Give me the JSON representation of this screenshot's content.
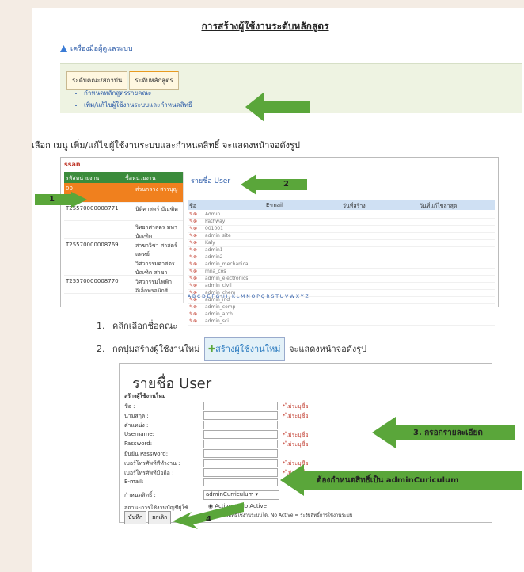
{
  "title": "การสร้างผู้ใช้งานระดับหลักสูตร",
  "admin": {
    "label": "เครื่องมือผู้ดูแลระบบ"
  },
  "tabs": [
    "ระดับคณะ/สถาบัน",
    "ระดับหลักสูตร"
  ],
  "menu": [
    "กำหนดหลักสูตรรายคณะ",
    "เพิ่ม/แก้ไขผู้ใช้งานระบบและกำหนดสิทธิ์"
  ],
  "sentence": "เลือก เมนู เพิ่ม/แก้ไขผู้ใช้งานระบบและกำหนดสิทธิ์ จะแสดงหน้าจอดังรูป",
  "shot1": {
    "logo": "ssan",
    "right": "",
    "left_headers": [
      "รหัสหน่วยงาน",
      "ชื่อหน่วยงาน"
    ],
    "left_rows": [
      {
        "code": "00",
        "name": "ส่วนกลาง สารบุญ",
        "selected": true
      },
      {
        "code": "T25570000008771",
        "name": "นิติศาสตร์ บัณฑิต",
        "selected": false
      },
      {
        "code": "",
        "name": "วิทยาศาสตร มหาบัณฑิต",
        "selected": false
      },
      {
        "code": "T25570000008769",
        "name": "สาขาวิชา ศาสตร์แพทย์",
        "selected": false
      },
      {
        "code": "",
        "name": "วิศวกรรมศาสตร บัณฑิต สาขา",
        "selected": false
      },
      {
        "code": "T25570000008770",
        "name": "วิศวกรรมไฟฟ้า อิเล็กทรอนิกส์",
        "selected": false
      }
    ],
    "list_title": "รายชื่อ User",
    "list_headers": [
      "ชื่อ",
      "E-mail",
      "วันที่สร้าง",
      "วันที่แก้ไขล่าสุด"
    ],
    "rows": [
      {
        "name": "Admin",
        "email": "",
        "created": "",
        "updated": ""
      },
      {
        "name": "Pathway",
        "email": "",
        "created": "",
        "updated": ""
      },
      {
        "name": "001001",
        "email": "",
        "created": "",
        "updated": ""
      },
      {
        "name": "admin_site",
        "email": "",
        "created": "",
        "updated": ""
      },
      {
        "name": "Kaly",
        "email": "",
        "created": "",
        "updated": ""
      },
      {
        "name": "admin1",
        "email": "",
        "created": "",
        "updated": ""
      },
      {
        "name": "admin2",
        "email": "",
        "created": "",
        "updated": ""
      },
      {
        "name": "admin_mechanical",
        "email": "",
        "created": "",
        "updated": ""
      },
      {
        "name": "mna_cos",
        "email": "",
        "created": "",
        "updated": ""
      },
      {
        "name": "admin_electronics",
        "email": "",
        "created": "",
        "updated": ""
      },
      {
        "name": "admin_civil",
        "email": "",
        "created": "",
        "updated": ""
      },
      {
        "name": "admin_chem",
        "email": "",
        "created": "",
        "updated": ""
      },
      {
        "name": "admin_ind",
        "email": "",
        "created": "",
        "updated": ""
      },
      {
        "name": "admin_comp",
        "email": "",
        "created": "",
        "updated": ""
      },
      {
        "name": "admin_arch",
        "email": "",
        "created": "",
        "updated": ""
      },
      {
        "name": "admin_sci",
        "email": "",
        "created": "",
        "updated": ""
      }
    ],
    "alpha": "A B C D E F G H I J K L M N O P Q R S T U V W X Y Z"
  },
  "steps": [
    {
      "num": "1.",
      "text": "คลิกเลือกชื่อคณะ"
    },
    {
      "num": "2.",
      "text_before": "กดปุ่มสร้างผู้ใช้งานใหม่",
      "button": "สร้างผู้ใช้งานใหม่",
      "text_after": "จะแสดงหน้าจอดังรูป"
    }
  ],
  "form": {
    "title": "รายชื่อ User",
    "subtitle": "สร้างผู้ใช้งานใหม่",
    "fields": [
      {
        "label": "ชื่อ :",
        "required": "*ไม่ระบุชื่อ"
      },
      {
        "label": "นามสกุล :",
        "required": "*ไม่ระบุชื่อ"
      },
      {
        "label": "ตำแหน่ง :",
        "required": ""
      },
      {
        "label": "Username:",
        "required": "*ไม่ระบุชื่อ"
      },
      {
        "label": "Password:",
        "required": "*ไม่ระบุชื่อ"
      },
      {
        "label": "ยืนยัน Password:",
        "required": ""
      },
      {
        "label": "เบอร์โทรศัพท์ที่ทำงาน :",
        "required": "*ไม่ระบุชื่อ"
      },
      {
        "label": "เบอร์โทรศัพท์มือถือ :",
        "required": "*ไม่ระบุชื่อ"
      },
      {
        "label": "E-mail:",
        "required": ""
      }
    ],
    "role_label": "กำหนดสิทธิ์ :",
    "role_value": "adminCurriculum",
    "status_label": "สถานะการใช้งานบัญชีผู้ใช้",
    "active": "Active",
    "no_active": "No Active",
    "note": "Active = มีสิทธิ์ใช้งานระบบได้, No Active = ระงับสิทธิ์การใช้งานระบบ",
    "save": "บันทึก",
    "cancel": "ยกเลิก"
  },
  "callouts": {
    "one": "1",
    "two": "2",
    "three": "3. กรอกรายละเอียด",
    "role": "ต้องกำหนดสิทธิ์เป็น adminCuriculum",
    "four": "4"
  },
  "colors": {
    "arrow": "#5aa63a",
    "orange": "#f0801e",
    "link": "#2a5aa8"
  }
}
